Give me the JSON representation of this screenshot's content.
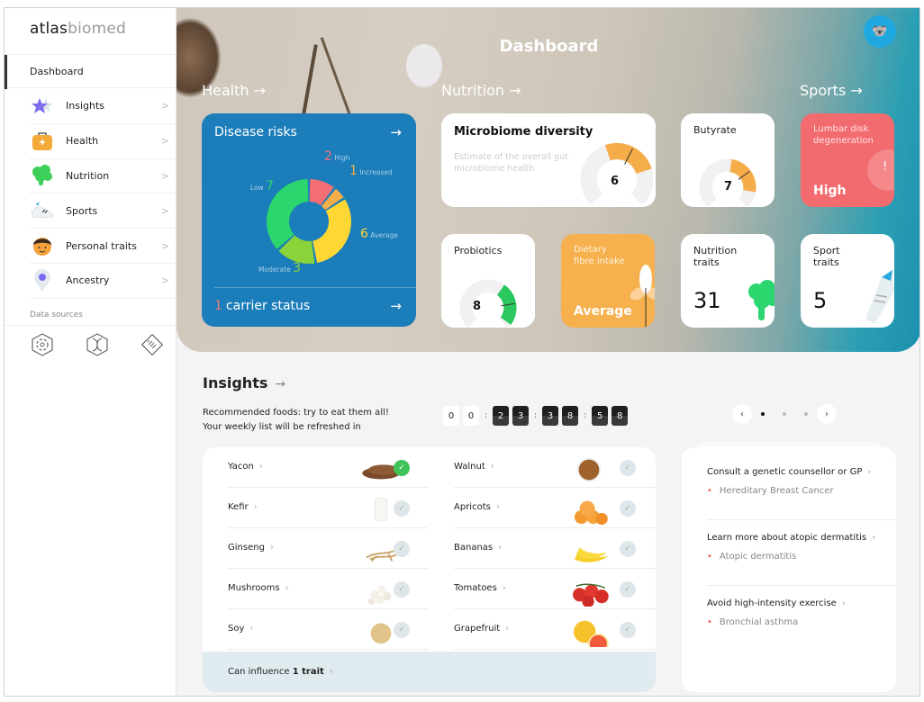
{
  "brand": {
    "logo_bold": "atlas",
    "logo_light": "biomed"
  },
  "sidebar": {
    "active": "Dashboard",
    "items": [
      {
        "label": "Insights",
        "icon": "star-icon"
      },
      {
        "label": "Health",
        "icon": "medkit-icon"
      },
      {
        "label": "Nutrition",
        "icon": "broccoli-icon"
      },
      {
        "label": "Sports",
        "icon": "sneaker-icon"
      },
      {
        "label": "Personal traits",
        "icon": "face-icon"
      },
      {
        "label": "Ancestry",
        "icon": "location-pin-icon"
      }
    ],
    "chevron": ">",
    "data_sources_label": "Data sources",
    "data_sources": [
      "microbiome-test-icon",
      "dna-test-icon",
      "report-icon"
    ]
  },
  "hero": {
    "title": "Dashboard",
    "sections": {
      "health": "Health →",
      "nutrition": "Nutrition →",
      "sports": "Sports →"
    }
  },
  "disease_risks": {
    "title": "Disease risks",
    "arrow": "→",
    "segments": [
      {
        "label": "High",
        "value": 2,
        "color": "#f46f73"
      },
      {
        "label": "Increased",
        "value": 1,
        "color": "#f5ad4a"
      },
      {
        "label": "Average",
        "value": 6,
        "color": "#fdd835"
      },
      {
        "label": "Moderate",
        "value": 3,
        "color": "#8bd33a"
      },
      {
        "label": "Low",
        "value": 7,
        "color": "#2bd66e"
      }
    ],
    "carrier_count": "1",
    "carrier_label": "carrier status"
  },
  "microbiome": {
    "title": "Microbiome diversity",
    "subtitle": "Estimate of the overall gut microbiome health",
    "value": "6",
    "scale_max": 10
  },
  "butyrate": {
    "title": "Butyrate",
    "value": "7",
    "scale_max": 10
  },
  "lumbar": {
    "title": "Lumbar disk degeneration",
    "status": "High",
    "mark": "!"
  },
  "probiotics": {
    "title": "Probiotics",
    "value": "8",
    "scale_max": 10
  },
  "fibre": {
    "title": "Dietary fibre intake",
    "status": "Average"
  },
  "nutrition_traits": {
    "title": "Nutrition traits",
    "value": "31"
  },
  "sport_traits": {
    "title": "Sport traits",
    "value": "5"
  },
  "insights": {
    "title": "Insights",
    "arrow": "→",
    "line1": "Recommended foods: try to eat them all!",
    "line2": "Your weekly list will be refreshed in",
    "timer": {
      "days": [
        "0",
        "0"
      ],
      "hours": [
        "2",
        "3"
      ],
      "minutes": [
        "3",
        "8"
      ],
      "seconds": [
        "5",
        "8"
      ]
    },
    "pager": {
      "prev": "‹",
      "next": "›",
      "pages": 3,
      "current": 1
    }
  },
  "foods": {
    "left": [
      {
        "name": "Yacon",
        "checked": true
      },
      {
        "name": "Kefir",
        "checked": false
      },
      {
        "name": "Ginseng",
        "checked": false
      },
      {
        "name": "Mushrooms",
        "checked": false
      },
      {
        "name": "Soy",
        "checked": false
      }
    ],
    "right": [
      {
        "name": "Walnut",
        "checked": false
      },
      {
        "name": "Apricots",
        "checked": false
      },
      {
        "name": "Bananas",
        "checked": false
      },
      {
        "name": "Tomatoes",
        "checked": false
      },
      {
        "name": "Grapefruit",
        "checked": false
      }
    ],
    "influence_prefix": "Can influence ",
    "influence_bold": "1 trait"
  },
  "recommendations": [
    {
      "title": "Consult a genetic counsellor or GP",
      "condition": "Hereditary Breast Cancer"
    },
    {
      "title": "Learn more about atopic dermatitis",
      "condition": "Atopic dermatitis"
    },
    {
      "title": "Avoid high-intensity exercise",
      "condition": "Bronchial asthma"
    }
  ]
}
